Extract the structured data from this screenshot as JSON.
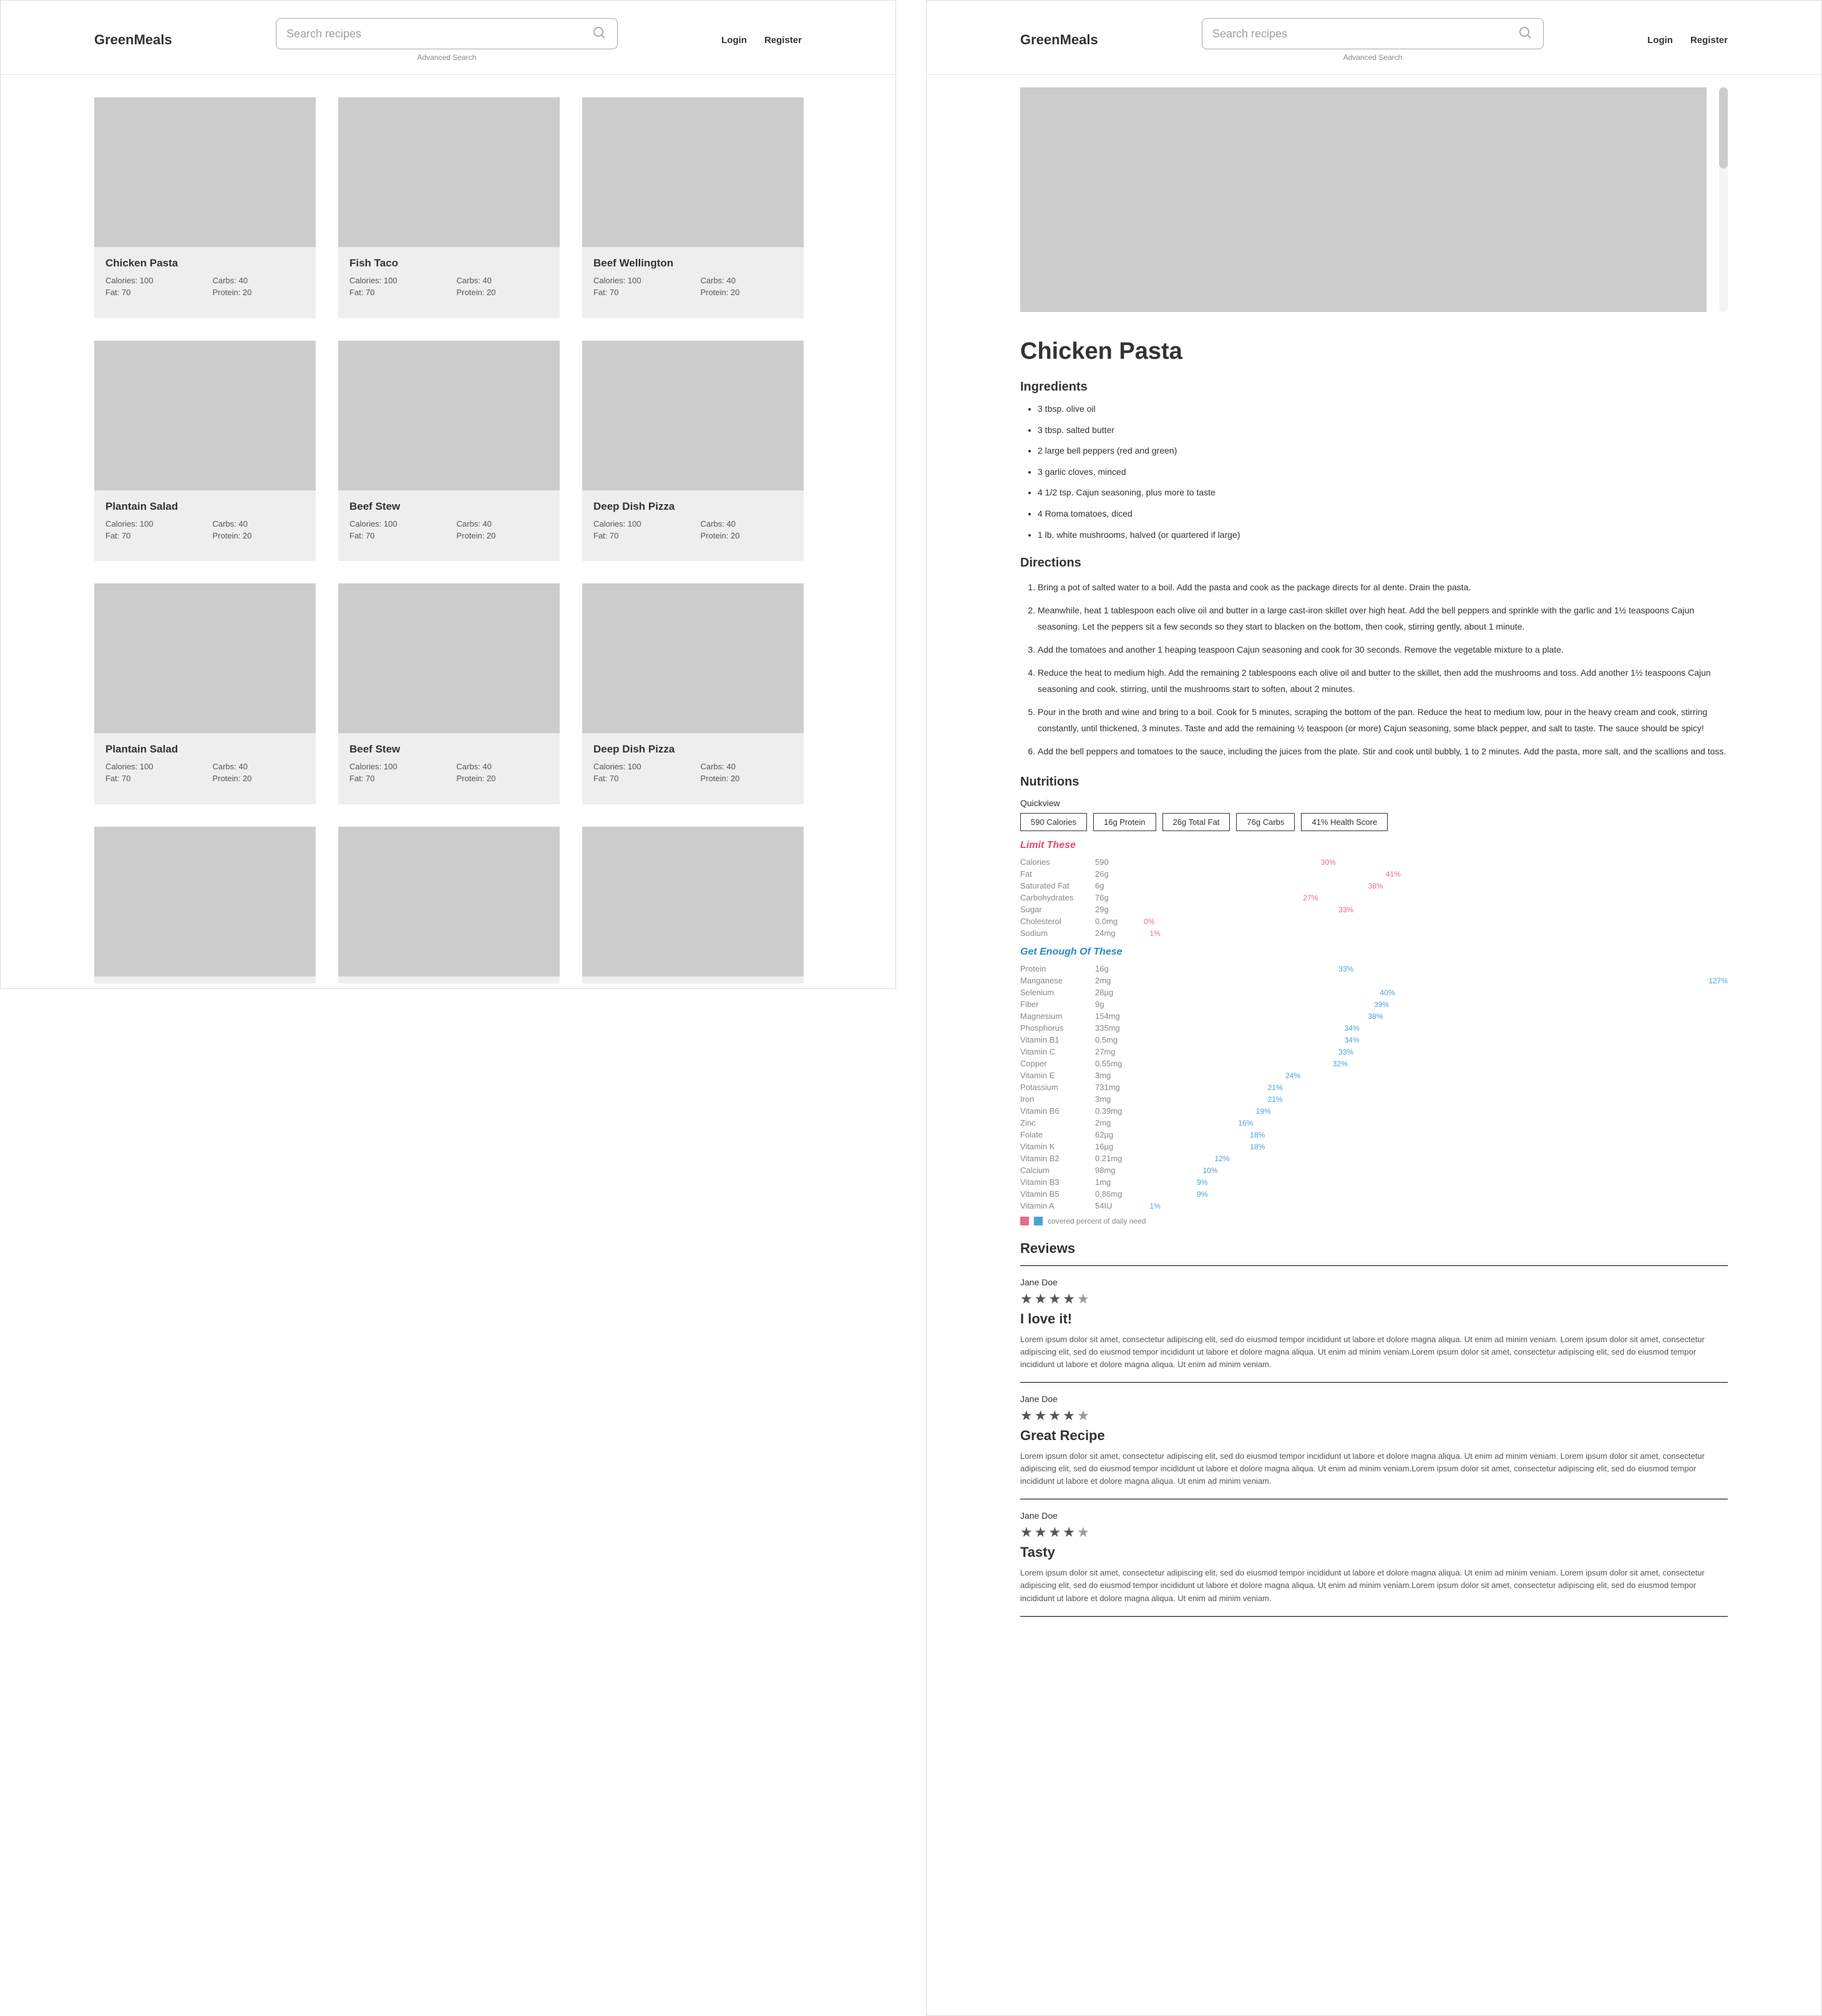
{
  "brand": "GreenMeals",
  "search": {
    "placeholder": "Search recipes"
  },
  "advanced": "Advanced Search",
  "auth": {
    "login": "Login",
    "register": "Register"
  },
  "cards": [
    {
      "title": "Chicken Pasta",
      "cal": "Calories: 100",
      "carbs": "Carbs: 40",
      "fat": "Fat: 70",
      "prot": "Protein: 20"
    },
    {
      "title": "Fish Taco",
      "cal": "Calories: 100",
      "carbs": "Carbs: 40",
      "fat": "Fat: 70",
      "prot": "Protein: 20"
    },
    {
      "title": "Beef Wellington",
      "cal": "Calories: 100",
      "carbs": "Carbs: 40",
      "fat": "Fat: 70",
      "prot": "Protein: 20"
    },
    {
      "title": "Plantain Salad",
      "cal": "Calories: 100",
      "carbs": "Carbs: 40",
      "fat": "Fat: 70",
      "prot": "Protein: 20"
    },
    {
      "title": "Beef Stew",
      "cal": "Calories: 100",
      "carbs": "Carbs: 40",
      "fat": "Fat: 70",
      "prot": "Protein: 20"
    },
    {
      "title": "Deep Dish Pizza",
      "cal": "Calories: 100",
      "carbs": "Carbs: 40",
      "fat": "Fat: 70",
      "prot": "Protein: 20"
    },
    {
      "title": "Plantain Salad",
      "cal": "Calories: 100",
      "carbs": "Carbs: 40",
      "fat": "Fat: 70",
      "prot": "Protein: 20"
    },
    {
      "title": "Beef Stew",
      "cal": "Calories: 100",
      "carbs": "Carbs: 40",
      "fat": "Fat: 70",
      "prot": "Protein: 20"
    },
    {
      "title": "Deep Dish Pizza",
      "cal": "Calories: 100",
      "carbs": "Carbs: 40",
      "fat": "Fat: 70",
      "prot": "Protein: 20"
    },
    {
      "title": "",
      "cal": "",
      "carbs": "",
      "fat": "",
      "prot": ""
    },
    {
      "title": "",
      "cal": "",
      "carbs": "",
      "fat": "",
      "prot": ""
    },
    {
      "title": "",
      "cal": "",
      "carbs": "",
      "fat": "",
      "prot": ""
    }
  ],
  "detail": {
    "title": "Chicken Pasta",
    "ingredients_h": "Ingredients",
    "ingredients": [
      "3 tbsp. olive oil",
      "3 tbsp. salted butter",
      "2 large bell peppers (red and green)",
      "3 garlic cloves, minced",
      "4 1/2 tsp. Cajun seasoning, plus more to taste",
      "4 Roma tomatoes, diced",
      "1 lb. white mushrooms, halved (or quartered if large)"
    ],
    "directions_h": "Directions",
    "directions": [
      "Bring a pot of salted water to a boil. Add the pasta and cook as the package directs for al dente. Drain the pasta.",
      "Meanwhile, heat 1 tablespoon each olive oil and butter in a large cast-iron skillet over high heat. Add the bell peppers and sprinkle with the garlic and 1½ teaspoons Cajun seasoning. Let the peppers sit a few seconds so they start to blacken on the bottom, then cook, stirring gently, about 1 minute.",
      "Add the tomatoes and another 1 heaping teaspoon Cajun seasoning and cook for 30 seconds. Remove the vegetable mixture to a plate.",
      "Reduce the heat to medium high. Add the remaining 2 tablespoons each olive oil and butter to the skillet, then add the mushrooms and toss. Add another 1½ teaspoons Cajun seasoning and cook, stirring, until the mushrooms start to soften, about 2 minutes.",
      "Pour in the broth and wine and bring to a boil. Cook for 5 minutes, scraping the bottom of the pan. Reduce the heat to medium low, pour in the heavy cream and cook, stirring constantly, until thickened, 3 minutes. Taste and add the remaining ½ teaspoon (or more) Cajun seasoning, some black pepper, and salt to taste. The sauce should be spicy!",
      "Add the bell peppers and tomatoes to the sauce, including the juices from the plate. Stir and cook until bubbly, 1 to 2 minutes. Add the pasta, more salt, and the scallions and toss."
    ],
    "nutri_h": "Nutritions",
    "quickview_label": "Quickview",
    "quickview": [
      "590 Calories",
      "16g Protein",
      "26g Total Fat",
      "76g Carbs",
      "41% Health Score"
    ],
    "limit_h": "Limit These",
    "limit": [
      {
        "name": "Calories",
        "amt": "590",
        "pct": "30%",
        "w": 30
      },
      {
        "name": "Fat",
        "amt": "26g",
        "pct": "41%",
        "w": 41
      },
      {
        "name": "Saturated Fat",
        "amt": "6g",
        "pct": "38%",
        "w": 38
      },
      {
        "name": "Carbohydrates",
        "amt": "76g",
        "pct": "27%",
        "w": 27
      },
      {
        "name": "Sugar",
        "amt": "29g",
        "pct": "33%",
        "w": 33
      },
      {
        "name": "Cholesterol",
        "amt": "0.0mg",
        "pct": "0%",
        "w": 0
      },
      {
        "name": "Sodium",
        "amt": "24mg",
        "pct": "1%",
        "w": 1
      }
    ],
    "enough_h": "Get Enough Of These",
    "enough": [
      {
        "name": "Protein",
        "amt": "16g",
        "pct": "33%",
        "w": 33
      },
      {
        "name": "Manganese",
        "amt": "2mg",
        "pct": "127%",
        "w": 100
      },
      {
        "name": "Selenium",
        "amt": "28µg",
        "pct": "40%",
        "w": 40
      },
      {
        "name": "Fiber",
        "amt": "9g",
        "pct": "39%",
        "w": 39
      },
      {
        "name": "Magnesium",
        "amt": "154mg",
        "pct": "38%",
        "w": 38
      },
      {
        "name": "Phosphorus",
        "amt": "335mg",
        "pct": "34%",
        "w": 34
      },
      {
        "name": "Vitamin B1",
        "amt": "0.5mg",
        "pct": "34%",
        "w": 34
      },
      {
        "name": "Vitamin C",
        "amt": "27mg",
        "pct": "33%",
        "w": 33
      },
      {
        "name": "Copper",
        "amt": "0.55mg",
        "pct": "32%",
        "w": 32
      },
      {
        "name": "Vitamin E",
        "amt": "3mg",
        "pct": "24%",
        "w": 24
      },
      {
        "name": "Potassium",
        "amt": "731mg",
        "pct": "21%",
        "w": 21
      },
      {
        "name": "Iron",
        "amt": "3mg",
        "pct": "21%",
        "w": 21
      },
      {
        "name": "Vitamin B6",
        "amt": "0.39mg",
        "pct": "19%",
        "w": 19
      },
      {
        "name": "Zinc",
        "amt": "2mg",
        "pct": "16%",
        "w": 16
      },
      {
        "name": "Folate",
        "amt": "62µg",
        "pct": "18%",
        "w": 18
      },
      {
        "name": "Vitamin K",
        "amt": "16µg",
        "pct": "18%",
        "w": 18
      },
      {
        "name": "Vitamin B2",
        "amt": "0.21mg",
        "pct": "12%",
        "w": 12
      },
      {
        "name": "Calcium",
        "amt": "98mg",
        "pct": "10%",
        "w": 10
      },
      {
        "name": "Vitamin B3",
        "amt": "1mg",
        "pct": "9%",
        "w": 9
      },
      {
        "name": "Vitamin B5",
        "amt": "0.86mg",
        "pct": "9%",
        "w": 9
      },
      {
        "name": "Vitamin A",
        "amt": "54IU",
        "pct": "1%",
        "w": 1
      }
    ],
    "cred": "covered percent of daily need",
    "reviews_h": "Reviews",
    "reviews": [
      {
        "name": "Jane Doe",
        "stars": 4,
        "title": "I love it!",
        "body": "Lorem ipsum dolor sit amet, consectetur adipiscing elit, sed do eiusmod tempor incididunt ut labore et dolore magna aliqua. Ut enim ad minim veniam. Lorem ipsum dolor sit amet, consectetur adipiscing elit, sed do eiusmod tempor incididunt ut labore et dolore magna aliqua. Ut enim ad minim veniam.Lorem ipsum dolor sit amet, consectetur adipiscing elit, sed do eiusmod tempor incididunt ut labore et dolore magna aliqua. Ut enim ad minim veniam."
      },
      {
        "name": "Jane Doe",
        "stars": 4,
        "title": "Great Recipe",
        "body": "Lorem ipsum dolor sit amet, consectetur adipiscing elit, sed do eiusmod tempor incididunt ut labore et dolore magna aliqua. Ut enim ad minim veniam. Lorem ipsum dolor sit amet, consectetur adipiscing elit, sed do eiusmod tempor incididunt ut labore et dolore magna aliqua. Ut enim ad minim veniam.Lorem ipsum dolor sit amet, consectetur adipiscing elit, sed do eiusmod tempor incididunt ut labore et dolore magna aliqua. Ut enim ad minim veniam."
      },
      {
        "name": "Jane Doe",
        "stars": 4,
        "title": "Tasty",
        "body": "Lorem ipsum dolor sit amet, consectetur adipiscing elit, sed do eiusmod tempor incididunt ut labore et dolore magna aliqua. Ut enim ad minim veniam. Lorem ipsum dolor sit amet, consectetur adipiscing elit, sed do eiusmod tempor incididunt ut labore et dolore magna aliqua. Ut enim ad minim veniam.Lorem ipsum dolor sit amet, consectetur adipiscing elit, sed do eiusmod tempor incididunt ut labore et dolore magna aliqua. Ut enim ad minim veniam."
      }
    ]
  },
  "chart_data": {
    "type": "bar",
    "title": "Nutritions",
    "series": [
      {
        "name": "Limit These",
        "color": "#e86b87",
        "categories": [
          "Calories",
          "Fat",
          "Saturated Fat",
          "Carbohydrates",
          "Sugar",
          "Cholesterol",
          "Sodium"
        ],
        "values": [
          30,
          41,
          38,
          27,
          33,
          0,
          1
        ]
      },
      {
        "name": "Get Enough Of These",
        "color": "#4aa3d8",
        "categories": [
          "Protein",
          "Manganese",
          "Selenium",
          "Fiber",
          "Magnesium",
          "Phosphorus",
          "Vitamin B1",
          "Vitamin C",
          "Copper",
          "Vitamin E",
          "Potassium",
          "Iron",
          "Vitamin B6",
          "Zinc",
          "Folate",
          "Vitamin K",
          "Vitamin B2",
          "Calcium",
          "Vitamin B3",
          "Vitamin B5",
          "Vitamin A"
        ],
        "values": [
          33,
          127,
          40,
          39,
          38,
          34,
          34,
          33,
          32,
          24,
          21,
          21,
          19,
          16,
          18,
          18,
          12,
          10,
          9,
          9,
          1
        ]
      }
    ],
    "xlabel": "",
    "ylabel": "% daily need"
  }
}
